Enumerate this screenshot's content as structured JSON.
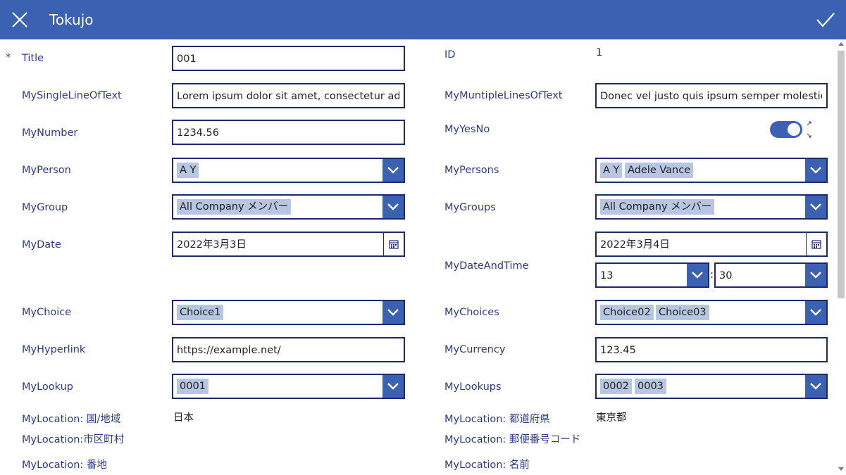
{
  "header": {
    "title": "Tokujo"
  },
  "form": {
    "required_mark": "*",
    "title": {
      "label": "Title",
      "value": "001"
    },
    "id": {
      "label": "ID",
      "value": "1"
    },
    "single_line": {
      "label": "MySingleLineOfText",
      "value": "Lorem ipsum dolor sit amet, consectetur adipiscing elit"
    },
    "multi_line": {
      "label": "MyMuntipleLinesOfText",
      "value": "Donec vel justo quis ipsum semper molestie."
    },
    "number": {
      "label": "MyNumber",
      "value": "1234.56"
    },
    "yesno": {
      "label": "MyYesNo",
      "value": true
    },
    "person": {
      "label": "MyPerson",
      "chips": [
        "A Y"
      ]
    },
    "persons": {
      "label": "MyPersons",
      "chips": [
        "A Y",
        "Adele Vance"
      ]
    },
    "group": {
      "label": "MyGroup",
      "chips": [
        "All Company メンバー"
      ]
    },
    "groups": {
      "label": "MyGroups",
      "chips": [
        "All Company メンバー"
      ]
    },
    "date": {
      "label": "MyDate",
      "value": "2022年3月3日"
    },
    "datetime": {
      "label": "MyDateAndTime",
      "date": "2022年3月4日",
      "hour": "13",
      "separator": ":",
      "minute": "30"
    },
    "choice": {
      "label": "MyChoice",
      "chips": [
        "Choice1"
      ]
    },
    "choices": {
      "label": "MyChoices",
      "chips": [
        "Choice02",
        "Choice03"
      ]
    },
    "hyperlink": {
      "label": "MyHyperlink",
      "value": "https://example.net/"
    },
    "currency": {
      "label": "MyCurrency",
      "value": "123.45"
    },
    "lookup": {
      "label": "MyLookup",
      "chips": [
        "0001"
      ]
    },
    "lookups": {
      "label": "MyLookups",
      "chips": [
        "0002",
        "0003"
      ]
    },
    "location_country": {
      "label": "MyLocation: 国/地域",
      "value": "日本"
    },
    "location_state": {
      "label": "MyLocation: 都道府県",
      "value": "東京都"
    },
    "location_city": {
      "label": "MyLocation:市区町村"
    },
    "location_postal": {
      "label": "MyLocation: 郵便番号コード"
    },
    "location_street": {
      "label": "MyLocation: 番地"
    },
    "location_name": {
      "label": "MyLocation: 名前"
    }
  },
  "icons": [
    "close-icon",
    "checkmark-icon",
    "chevron-down-icon",
    "calendar-icon"
  ],
  "colors": {
    "header": "#3b61b3",
    "label": "#2d3a87",
    "border": "#1c2a6b",
    "chip": "#b7c6e2"
  }
}
